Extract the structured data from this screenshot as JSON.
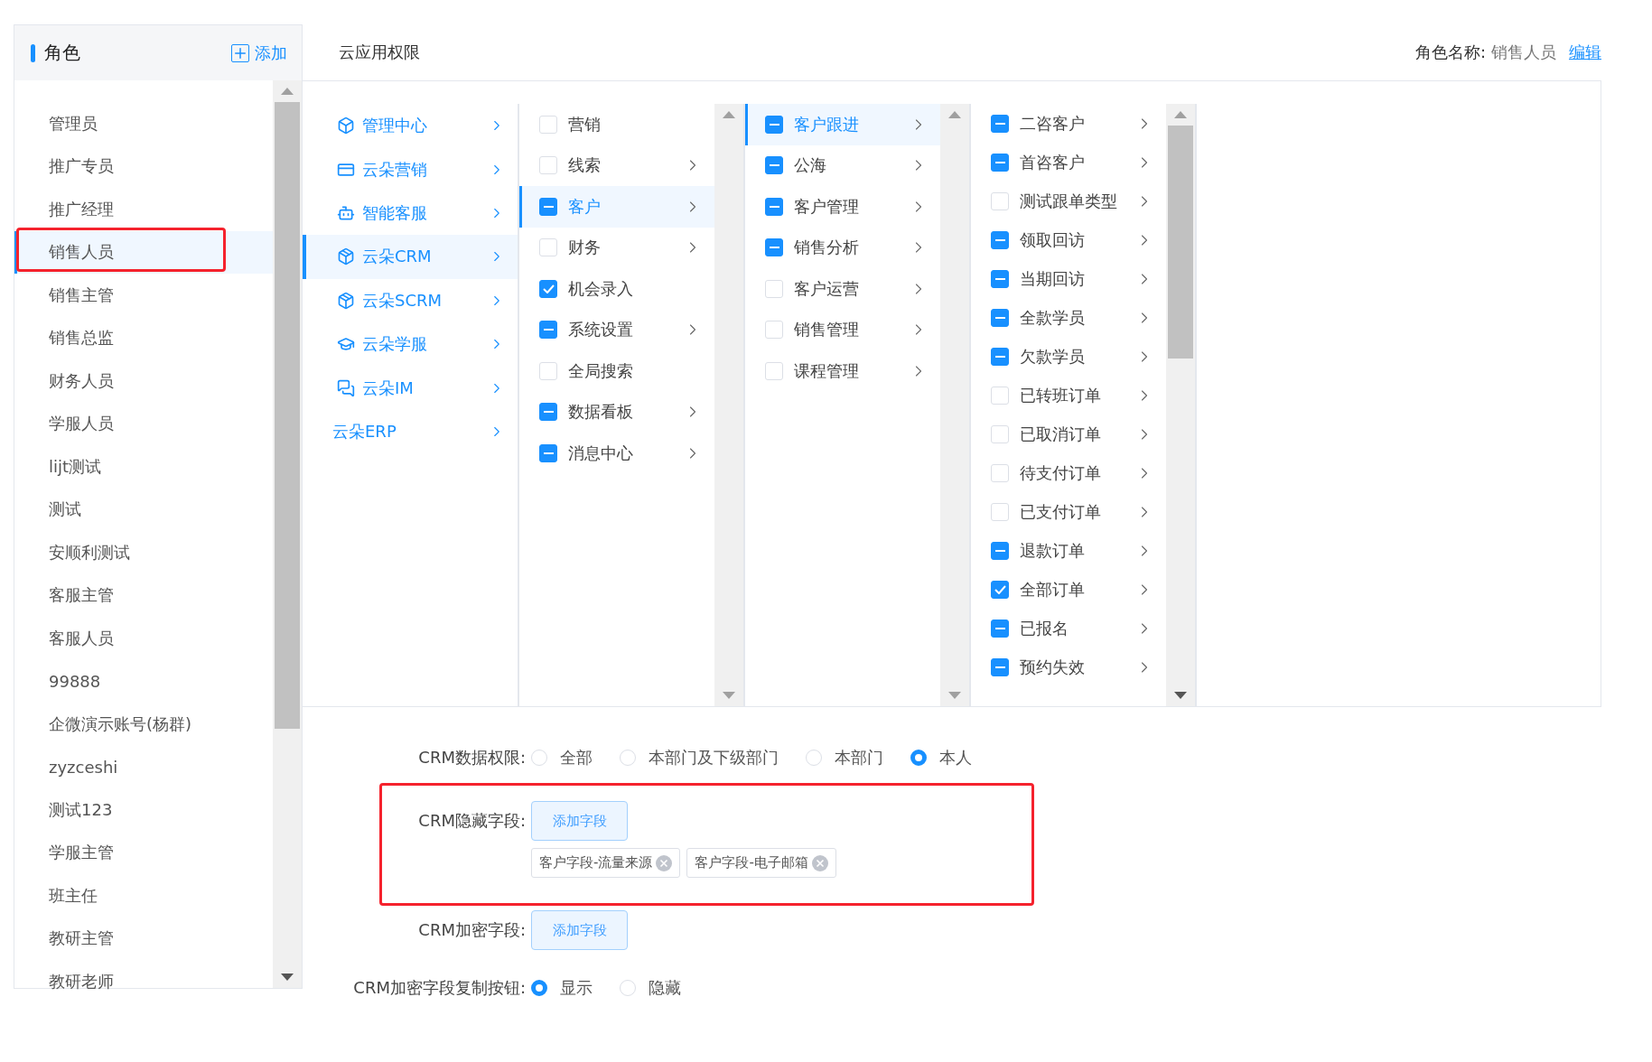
{
  "sidebar": {
    "title": "角色",
    "add_label": "添加",
    "roles": [
      {
        "label": "管理员",
        "selected": false,
        "highlighted": false
      },
      {
        "label": "推广专员",
        "selected": false,
        "highlighted": false
      },
      {
        "label": "推广经理",
        "selected": false,
        "highlighted": false
      },
      {
        "label": "销售人员",
        "selected": true,
        "highlighted": true
      },
      {
        "label": "销售主管",
        "selected": false,
        "highlighted": false
      },
      {
        "label": "销售总监",
        "selected": false,
        "highlighted": false
      },
      {
        "label": "财务人员",
        "selected": false,
        "highlighted": false
      },
      {
        "label": "学服人员",
        "selected": false,
        "highlighted": false
      },
      {
        "label": "lijt测试",
        "selected": false,
        "highlighted": false
      },
      {
        "label": "测试",
        "selected": false,
        "highlighted": false
      },
      {
        "label": "安顺利测试",
        "selected": false,
        "highlighted": false
      },
      {
        "label": "客服主管",
        "selected": false,
        "highlighted": false
      },
      {
        "label": "客服人员",
        "selected": false,
        "highlighted": false
      },
      {
        "label": "99888",
        "selected": false,
        "highlighted": false
      },
      {
        "label": "企微演示账号(杨群)",
        "selected": false,
        "highlighted": false
      },
      {
        "label": "zyzceshi",
        "selected": false,
        "highlighted": false
      },
      {
        "label": "测试123",
        "selected": false,
        "highlighted": false
      },
      {
        "label": "学服主管",
        "selected": false,
        "highlighted": false
      },
      {
        "label": "班主任",
        "selected": false,
        "highlighted": false
      },
      {
        "label": "教研主管",
        "selected": false,
        "highlighted": false
      },
      {
        "label": "教研老师",
        "selected": false,
        "highlighted": false
      }
    ]
  },
  "header": {
    "title": "云应用权限",
    "role_name_label": "角色名称:",
    "role_name": "销售人员",
    "edit_link": "编辑"
  },
  "apps": [
    {
      "label": "管理中心",
      "selected": false
    },
    {
      "label": "云朵营销",
      "selected": false
    },
    {
      "label": "智能客服",
      "selected": false
    },
    {
      "label": "云朵CRM",
      "selected": true
    },
    {
      "label": "云朵SCRM",
      "selected": false
    },
    {
      "label": "云朵学服",
      "selected": false
    },
    {
      "label": "云朵IM",
      "selected": false
    },
    {
      "label": "云朵ERP",
      "selected": false
    }
  ],
  "columns": [
    [
      {
        "label": "营销",
        "checked": false,
        "indeterminate": false,
        "expandable": false,
        "selected": false
      },
      {
        "label": "线索",
        "checked": false,
        "indeterminate": false,
        "expandable": true,
        "selected": false
      },
      {
        "label": "客户",
        "checked": false,
        "indeterminate": true,
        "expandable": true,
        "selected": true
      },
      {
        "label": "财务",
        "checked": false,
        "indeterminate": false,
        "expandable": true,
        "selected": false
      },
      {
        "label": "机会录入",
        "checked": true,
        "indeterminate": false,
        "expandable": false,
        "selected": false
      },
      {
        "label": "系统设置",
        "checked": false,
        "indeterminate": true,
        "expandable": true,
        "selected": false
      },
      {
        "label": "全局搜索",
        "checked": false,
        "indeterminate": false,
        "expandable": false,
        "selected": false
      },
      {
        "label": "数据看板",
        "checked": false,
        "indeterminate": true,
        "expandable": true,
        "selected": false
      },
      {
        "label": "消息中心",
        "checked": false,
        "indeterminate": true,
        "expandable": true,
        "selected": false
      }
    ],
    [
      {
        "label": "客户跟进",
        "checked": false,
        "indeterminate": true,
        "expandable": true,
        "selected": true
      },
      {
        "label": "公海",
        "checked": false,
        "indeterminate": true,
        "expandable": true,
        "selected": false
      },
      {
        "label": "客户管理",
        "checked": false,
        "indeterminate": true,
        "expandable": true,
        "selected": false
      },
      {
        "label": "销售分析",
        "checked": false,
        "indeterminate": true,
        "expandable": true,
        "selected": false
      },
      {
        "label": "客户运营",
        "checked": false,
        "indeterminate": false,
        "expandable": true,
        "selected": false
      },
      {
        "label": "销售管理",
        "checked": false,
        "indeterminate": false,
        "expandable": true,
        "selected": false
      },
      {
        "label": "课程管理",
        "checked": false,
        "indeterminate": false,
        "expandable": true,
        "selected": false
      }
    ],
    [
      {
        "label": "二咨客户",
        "checked": false,
        "indeterminate": true,
        "expandable": true,
        "selected": false
      },
      {
        "label": "首咨客户",
        "checked": false,
        "indeterminate": true,
        "expandable": true,
        "selected": false
      },
      {
        "label": "测试跟单类型",
        "checked": false,
        "indeterminate": false,
        "expandable": true,
        "selected": false
      },
      {
        "label": "领取回访",
        "checked": false,
        "indeterminate": true,
        "expandable": true,
        "selected": false
      },
      {
        "label": "当期回访",
        "checked": false,
        "indeterminate": true,
        "expandable": true,
        "selected": false
      },
      {
        "label": "全款学员",
        "checked": false,
        "indeterminate": true,
        "expandable": true,
        "selected": false
      },
      {
        "label": "欠款学员",
        "checked": false,
        "indeterminate": true,
        "expandable": true,
        "selected": false
      },
      {
        "label": "已转班订单",
        "checked": false,
        "indeterminate": false,
        "expandable": true,
        "selected": false
      },
      {
        "label": "已取消订单",
        "checked": false,
        "indeterminate": false,
        "expandable": true,
        "selected": false
      },
      {
        "label": "待支付订单",
        "checked": false,
        "indeterminate": false,
        "expandable": true,
        "selected": false
      },
      {
        "label": "已支付订单",
        "checked": false,
        "indeterminate": false,
        "expandable": true,
        "selected": false
      },
      {
        "label": "退款订单",
        "checked": false,
        "indeterminate": true,
        "expandable": true,
        "selected": false
      },
      {
        "label": "全部订单",
        "checked": true,
        "indeterminate": false,
        "expandable": true,
        "selected": false
      },
      {
        "label": "已报名",
        "checked": false,
        "indeterminate": true,
        "expandable": true,
        "selected": false
      },
      {
        "label": "预约失效",
        "checked": false,
        "indeterminate": true,
        "expandable": true,
        "selected": false
      }
    ]
  ],
  "form": [
    {
      "kind": "radio",
      "label": "CRM数据权限:",
      "highlighted": false,
      "options": [
        {
          "label": "全部",
          "selected": false
        },
        {
          "label": "本部门及下级部门",
          "selected": false
        },
        {
          "label": "本部门",
          "selected": false
        },
        {
          "label": "本人",
          "selected": true
        }
      ]
    },
    {
      "kind": "fields",
      "label": "CRM隐藏字段:",
      "highlighted": true,
      "button": "添加字段",
      "tags": [
        "客户字段-流量来源",
        "客户字段-电子邮箱"
      ]
    },
    {
      "kind": "fields",
      "label": "CRM加密字段:",
      "highlighted": false,
      "button": "添加字段"
    },
    {
      "kind": "radio",
      "label": "CRM加密字段复制按钮:",
      "highlighted": false,
      "options": [
        {
          "label": "显示",
          "selected": true
        },
        {
          "label": "隐藏",
          "selected": false
        }
      ]
    }
  ]
}
